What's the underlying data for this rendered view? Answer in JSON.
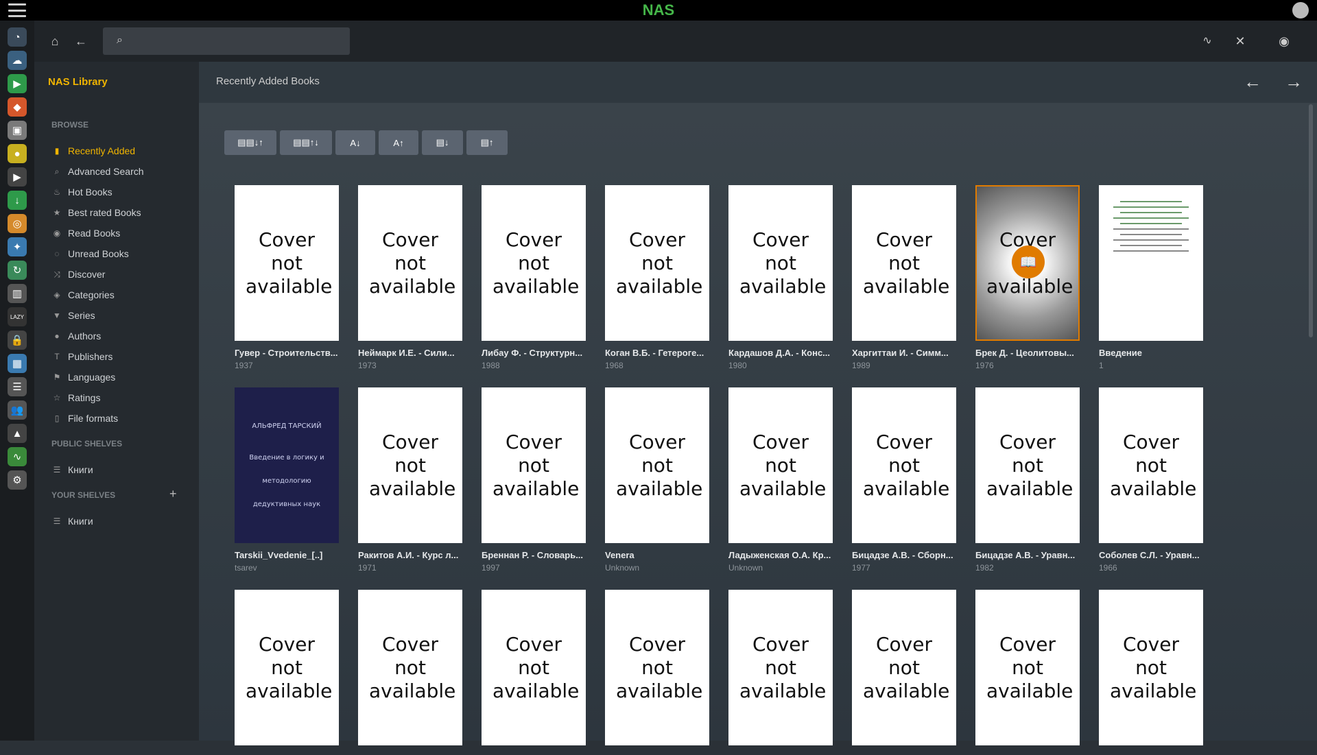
{
  "app": {
    "title": "NAS"
  },
  "search": {
    "placeholder": "",
    "value": ""
  },
  "sidebar": {
    "library_title": "NAS Library",
    "browse_label": "BROWSE",
    "items": [
      {
        "label": "Recently Added",
        "icon": "book-icon",
        "active": true
      },
      {
        "label": "Advanced Search",
        "icon": "search-icon"
      },
      {
        "label": "Hot Books",
        "icon": "fire-icon"
      },
      {
        "label": "Best rated Books",
        "icon": "star-icon"
      },
      {
        "label": "Read Books",
        "icon": "eye-icon"
      },
      {
        "label": "Unread Books",
        "icon": "eye-slash-icon"
      },
      {
        "label": "Discover",
        "icon": "shuffle-icon"
      },
      {
        "label": "Categories",
        "icon": "tags-icon"
      },
      {
        "label": "Series",
        "icon": "bookmark-icon"
      },
      {
        "label": "Authors",
        "icon": "user-icon"
      },
      {
        "label": "Publishers",
        "icon": "text-icon"
      },
      {
        "label": "Languages",
        "icon": "flag-icon"
      },
      {
        "label": "Ratings",
        "icon": "star-outline-icon"
      },
      {
        "label": "File formats",
        "icon": "file-icon"
      }
    ],
    "public_shelves_label": "PUBLIC SHELVES",
    "public_shelves": [
      {
        "label": "Книги"
      }
    ],
    "your_shelves_label": "YOUR SHELVES",
    "your_shelves": [
      {
        "label": "Книги"
      }
    ]
  },
  "main": {
    "title": "Recently Added Books",
    "sort_buttons": [
      "▤▤↓↑",
      "▤▤↑↓",
      "A↓",
      "A↑",
      "▤↓",
      "▤↑"
    ],
    "cover_placeholder": "Cover not available",
    "books": [
      {
        "title": "Гувер - Строительств...",
        "year": "1937",
        "cover": "none"
      },
      {
        "title": "Неймарк И.Е. - Сили...",
        "year": "1973",
        "cover": "none"
      },
      {
        "title": "Либау Ф. - Структурн...",
        "year": "1988",
        "cover": "none"
      },
      {
        "title": "Коган В.Б. - Гетероге...",
        "year": "1968",
        "cover": "none"
      },
      {
        "title": "Кардашов Д.А. - Конс...",
        "year": "1980",
        "cover": "none"
      },
      {
        "title": "Харгиттаи И. - Симм...",
        "year": "1989",
        "cover": "none"
      },
      {
        "title": "Брек Д. - Цеолитовы...",
        "year": "1976",
        "cover": "hover"
      },
      {
        "title": "Введение",
        "year": "1",
        "cover": "doc"
      },
      {
        "title": "Tarskii_Vvedenie_[..]",
        "year": "tsarev",
        "cover": "dark"
      },
      {
        "title": "Ракитов А.И. - Курс л...",
        "year": "1971",
        "cover": "none"
      },
      {
        "title": "Бреннан Р. - Словарь...",
        "year": "1997",
        "cover": "none"
      },
      {
        "title": "Venera",
        "year": "Unknown",
        "cover": "none"
      },
      {
        "title": "Ладыженская О.А. Кр...",
        "year": "Unknown",
        "cover": "none"
      },
      {
        "title": "Бицадзе А.В. - Сборн...",
        "year": "1977",
        "cover": "none"
      },
      {
        "title": "Бицадзе А.В. - Уравн...",
        "year": "1982",
        "cover": "none"
      },
      {
        "title": "Соболев С.Л. - Уравн...",
        "year": "1966",
        "cover": "none"
      },
      {
        "title": "",
        "year": "",
        "cover": "none"
      },
      {
        "title": "",
        "year": "",
        "cover": "none"
      },
      {
        "title": "",
        "year": "",
        "cover": "none"
      },
      {
        "title": "",
        "year": "",
        "cover": "none"
      },
      {
        "title": "",
        "year": "",
        "cover": "none"
      },
      {
        "title": "",
        "year": "",
        "cover": "none"
      },
      {
        "title": "",
        "year": "",
        "cover": "none"
      },
      {
        "title": "",
        "year": "",
        "cover": "none"
      }
    ],
    "dark_cover_text": [
      "АЛЬФРЕД ТАРСКИЙ",
      "Введение в логику и методологию дедуктивных наук"
    ]
  },
  "colors": {
    "accent": "#f0b400",
    "brand": "#45b649",
    "hover": "#e07b00"
  }
}
